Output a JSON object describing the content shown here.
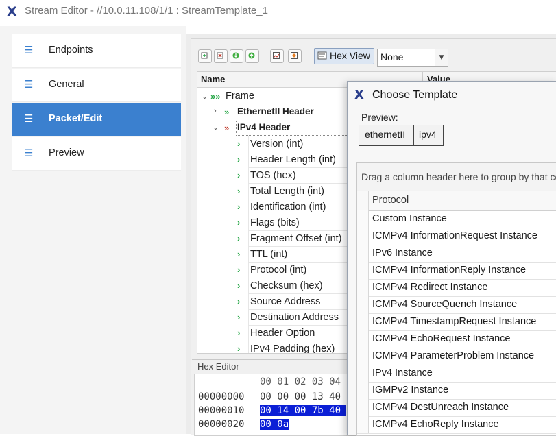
{
  "window": {
    "logo": "X",
    "title": "Stream Editor - //10.0.11.108/1/1 : StreamTemplate_1"
  },
  "sidebar": {
    "items": [
      {
        "label": "Endpoints",
        "icon": "menu-lines-icon",
        "active": false
      },
      {
        "label": "General",
        "icon": "menu-lines-icon",
        "active": false
      },
      {
        "label": "Packet/Edit",
        "icon": "menu-lines-icon",
        "active": true
      },
      {
        "label": "Preview",
        "icon": "menu-lines-icon",
        "active": false
      }
    ]
  },
  "toolbar": {
    "tools": [
      "add-header-icon",
      "delete-header-icon",
      "move-down-icon",
      "move-up-icon",
      "chart-icon",
      "settings-icon"
    ],
    "hex_view_label": "Hex View",
    "select_value": "None"
  },
  "tree": {
    "columns": {
      "name": "Name",
      "value": "Value"
    },
    "frame": "Frame",
    "headers": [
      {
        "label": "EthernetII Header",
        "expanded": false
      },
      {
        "label": "IPv4 Header",
        "expanded": true
      }
    ],
    "fields": [
      "Version (int)",
      "Header Length (int)",
      "TOS (hex)",
      "Total Length (int)",
      "Identification  (int)",
      "Flags (bits)",
      "Fragment Offset (int)",
      "TTL (int)",
      "Protocol (int)",
      "Checksum (hex)",
      "Source Address",
      "Destination Address",
      "Header Option",
      "IPv4 Padding (hex)"
    ]
  },
  "hex_editor": {
    "title": "Hex Editor",
    "columns": "00 01 02 03 04",
    "rows": [
      {
        "offset": "00000000",
        "bytes": "00 00 00 13 40",
        "highlighted": false
      },
      {
        "offset": "00000010",
        "bytes": "00 14 00 7b 40",
        "highlighted": true
      },
      {
        "offset": "00000020",
        "bytes": "00 0a",
        "highlighted": true
      }
    ]
  },
  "dialog": {
    "logo": "X",
    "title": "Choose Template",
    "preview_label": "Preview:",
    "chips": [
      "ethernetII",
      "ipv4"
    ],
    "group_hint": "Drag a column header here to group by that column",
    "column_header": "Protocol",
    "rows": [
      "Custom Instance",
      "ICMPv4 InformationRequest Instance",
      "IPv6 Instance",
      "ICMPv4 InformationReply Instance",
      "ICMPv4 Redirect Instance",
      "ICMPv4 SourceQuench Instance",
      "ICMPv4 TimestampRequest Instance",
      "ICMPv4 EchoRequest Instance",
      "ICMPv4 ParameterProblem Instance",
      "IPv4 Instance",
      "IGMPv2 Instance",
      "ICMPv4 DestUnreach Instance",
      "ICMPv4 EchoReply Instance"
    ]
  },
  "colors": {
    "accent": "#3b80cf",
    "logo": "#2b3f8c",
    "hex_highlight": "#0b1fd6",
    "arrow_green": "#2aa84a",
    "arrow_red": "#c0392b"
  }
}
